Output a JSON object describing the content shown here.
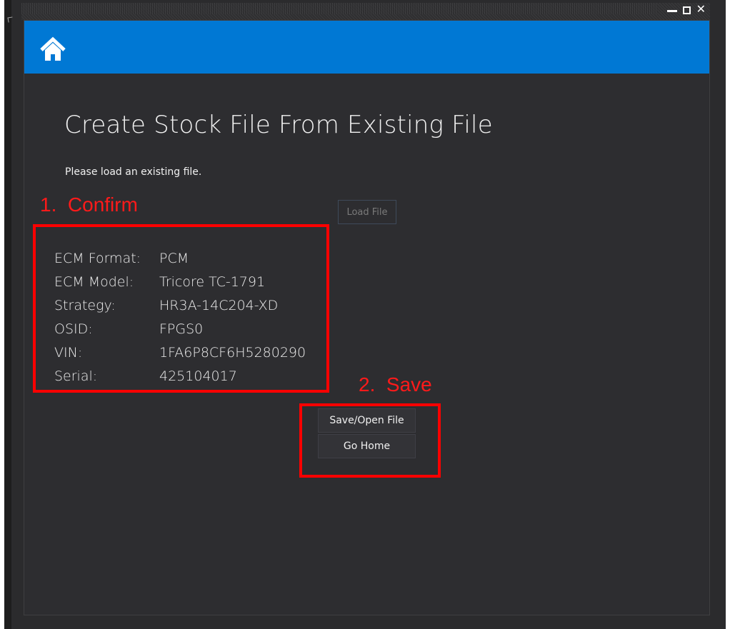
{
  "window": {
    "controls": {
      "minimize_icon": "minimize-icon",
      "maximize_icon": "maximize-icon",
      "close_icon": "close-icon",
      "close_glyph": "✕"
    }
  },
  "header": {
    "home_icon": "home-icon",
    "accent_color": "#0078d4"
  },
  "main": {
    "title": "Create Stock File From Existing File",
    "instruction": "Please load an existing file.",
    "load_button": "Load File",
    "info": [
      {
        "label": "ECM Format:",
        "value": "PCM"
      },
      {
        "label": "ECM Model:",
        "value": "Tricore TC-1791"
      },
      {
        "label": "Strategy:",
        "value": "HR3A-14C204-XD"
      },
      {
        "label": "OSID:",
        "value": "FPGS0"
      },
      {
        "label": "VIN:",
        "value": "1FA6P8CF6H5280290"
      },
      {
        "label": "Serial:",
        "value": "425104017"
      }
    ],
    "save_button": "Save/Open File",
    "home_button": "Go Home"
  },
  "annotations": {
    "step1": "1.  Confirm",
    "step2": "2.  Save",
    "color": "#ff0000"
  }
}
